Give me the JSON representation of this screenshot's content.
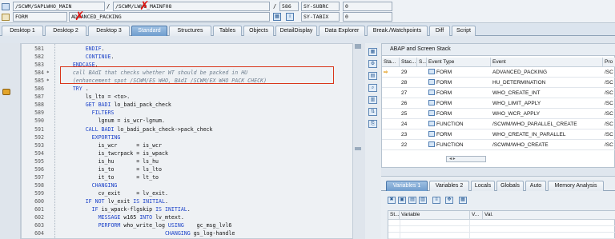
{
  "header": {
    "program": "/SCWM/SAPLWHO_MAIN",
    "include": "/SCWM/LWHO_MAINF08",
    "line_no": "586",
    "event_type": "FORM",
    "event_name": "ADVANCED_PACKING",
    "sysvar1_name": "SY-SUBRC",
    "sysvar1_value": "0",
    "sysvar2_name": "SY-TABIX",
    "sysvar2_value": "0",
    "slash": "/"
  },
  "tabs": [
    "Desktop 1",
    "Desktop 2",
    "Desktop 3",
    "Standard",
    "Structures",
    "Tables",
    "Objects",
    "DetailDisplay",
    "Data Explorer",
    "Break./Watchpoints",
    "Diff",
    "Script"
  ],
  "active_tab": "Standard",
  "code": [
    {
      "num": "581",
      "mark": "",
      "text": "          ENDIF."
    },
    {
      "num": "582",
      "mark": "",
      "text": "          CONTINUE."
    },
    {
      "num": "583",
      "mark": "",
      "text": "      ENDCASE."
    },
    {
      "num": "584",
      "mark": "*",
      "text": "      call BAdI that checks whether WT should be packed in HU",
      "comment": true
    },
    {
      "num": "585",
      "mark": "*",
      "text": "      (enhancement spot /SCWM/ES_WHO, BAdI /SCWM/EX_WHO_PACK_CHECK)",
      "comment": true
    },
    {
      "num": "586",
      "mark": "",
      "text": "      TRY ."
    },
    {
      "num": "587",
      "mark": "",
      "text": "          ls_lto = <to>."
    },
    {
      "num": "588",
      "mark": "",
      "text": "          GET BADI lo_badi_pack_check"
    },
    {
      "num": "589",
      "mark": "",
      "text": "            FILTERS"
    },
    {
      "num": "590",
      "mark": "",
      "text": "              lgnum = is_wcr-lgnum."
    },
    {
      "num": "591",
      "mark": "",
      "text": "          CALL BADI lo_badi_pack_check->pack_check"
    },
    {
      "num": "592",
      "mark": "",
      "text": "            EXPORTING"
    },
    {
      "num": "593",
      "mark": "",
      "text": "              is_wcr      = is_wcr"
    },
    {
      "num": "594",
      "mark": "",
      "text": "              is_twcrpack = is_wpack"
    },
    {
      "num": "595",
      "mark": "",
      "text": "              is_hu       = ls_hu"
    },
    {
      "num": "596",
      "mark": "",
      "text": "              is_to       = ls_lto"
    },
    {
      "num": "597",
      "mark": "",
      "text": "              it_to       = lt_to"
    },
    {
      "num": "598",
      "mark": "",
      "text": "            CHANGING"
    },
    {
      "num": "599",
      "mark": "",
      "text": "              cv_exit     = lv_exit."
    },
    {
      "num": "600",
      "mark": "",
      "text": "          IF NOT lv_exit IS INITIAL."
    },
    {
      "num": "601",
      "mark": "",
      "text": "            IF is_wpack-flgskip IS INITIAL."
    },
    {
      "num": "602",
      "mark": "",
      "text": "              MESSAGE w165 INTO lv_mtext."
    },
    {
      "num": "603",
      "mark": "",
      "text": "              PERFORM who_write_log USING    gc_msg_lvl6"
    },
    {
      "num": "604",
      "mark": "",
      "text": "                                   CHANGING gs_log-handle"
    }
  ],
  "stack": {
    "title": "ABAP and Screen Stack",
    "columns": [
      "Sta...",
      "Stac...",
      "S...",
      "Event Type",
      "Event",
      "Pro"
    ],
    "rows": [
      {
        "current": true,
        "level": "29",
        "type": "FORM",
        "event": "ADVANCED_PACKING",
        "prog": "/SC"
      },
      {
        "current": false,
        "level": "28",
        "type": "FORM",
        "event": "HU_DETERMINATION",
        "prog": "/SC"
      },
      {
        "current": false,
        "level": "27",
        "type": "FORM",
        "event": "WHO_CREATE_INT",
        "prog": "/SC"
      },
      {
        "current": false,
        "level": "26",
        "type": "FORM",
        "event": "WHO_LIMIT_APPLY",
        "prog": "/SC"
      },
      {
        "current": false,
        "level": "25",
        "type": "FORM",
        "event": "WHO_WCR_APPLY",
        "prog": "/SC"
      },
      {
        "current": false,
        "level": "24",
        "type": "FUNCTION",
        "event": "/SCWM/WHO_PARALLEL_CREATE",
        "prog": "/SC"
      },
      {
        "current": false,
        "level": "23",
        "type": "FORM",
        "event": "WHO_CREATE_IN_PARALLEL",
        "prog": "/SC"
      },
      {
        "current": false,
        "level": "22",
        "type": "FUNCTION",
        "event": "/SCWM/WHO_CREATE",
        "prog": "/SC"
      }
    ],
    "current_arrow": "⇨",
    "scroll_label": "◂ ▸"
  },
  "variables": {
    "tabs": [
      "Variables 1",
      "Variables 2",
      "Locals",
      "Globals",
      "Auto",
      "Memory Analysis"
    ],
    "active_tab": "Variables 1",
    "columns": [
      "St...",
      "Variable",
      "V...",
      "Val."
    ]
  },
  "colors": {
    "keyword": "#1e44c9",
    "comment": "#6f7f8f",
    "highlight_box": "#d9361b",
    "active_tab": "#6f9ccd"
  },
  "icons": [
    "table-icon",
    "form-icon",
    "red-x-icon",
    "breakpoint-icon",
    "arrow-icon"
  ]
}
